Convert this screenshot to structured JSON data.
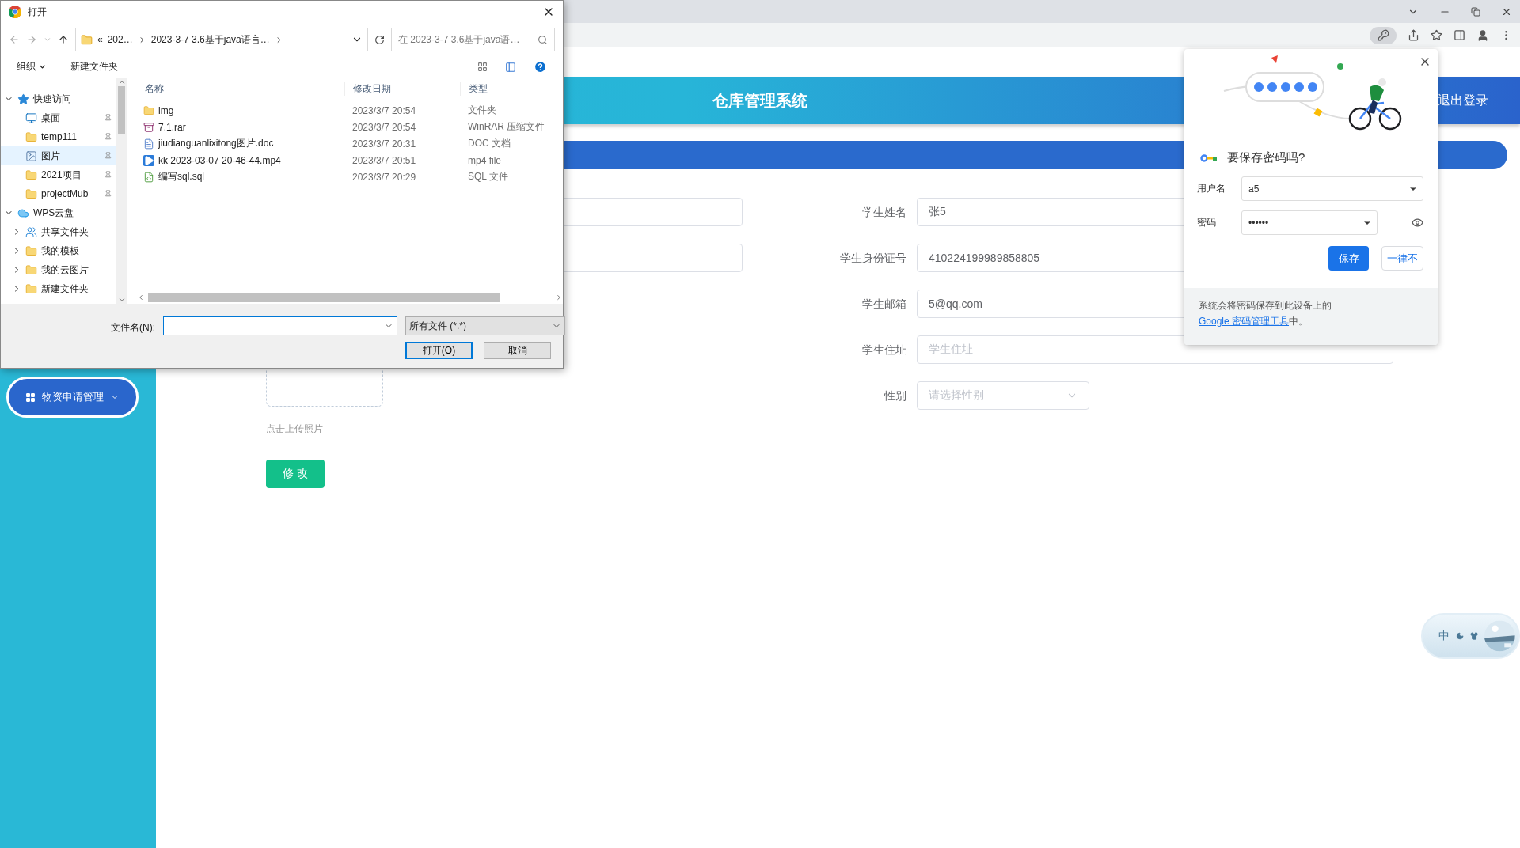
{
  "browser_toolbar": {
    "password_key_active": true
  },
  "app": {
    "title": "仓库管理系统",
    "logout": "退出登录"
  },
  "sidebar": {
    "items": [
      {
        "label": "物资申请管理",
        "expanded": false
      }
    ]
  },
  "form": {
    "left_column": [
      {
        "kind": "input"
      },
      {
        "kind": "input"
      }
    ],
    "fields": [
      {
        "label": "学生姓名",
        "kind": "input",
        "value": "张5"
      },
      {
        "label": "学生身份证号",
        "kind": "input",
        "value": "410224199989858805"
      },
      {
        "label": "学生邮箱",
        "kind": "input",
        "value": "5@qq.com"
      },
      {
        "label": "学生住址",
        "kind": "input",
        "placeholder": "学生住址"
      },
      {
        "label": "性别",
        "kind": "select",
        "placeholder": "请选择性别"
      }
    ],
    "upload_caption": "点击上传照片",
    "submit": "修 改"
  },
  "file_dialog": {
    "title": "打开",
    "breadcrumb_prefix": "«",
    "breadcrumb": [
      "202…",
      "2023-3-7 3.6基于java语言…"
    ],
    "search": {
      "placeholder": "在 2023-3-7 3.6基于java语…"
    },
    "commands": [
      {
        "label": "组织",
        "kind": "menu"
      },
      {
        "label": "新建文件夹",
        "kind": "button"
      }
    ],
    "nav": [
      {
        "label": "快速访问",
        "kind": "star",
        "expanded": true,
        "selected": false,
        "children": [
          {
            "label": "桌面",
            "kind": "desktop",
            "selected": false
          },
          {
            "label": "temp111",
            "kind": "folder",
            "selected": false
          },
          {
            "label": "图片",
            "kind": "pictures",
            "selected": true
          },
          {
            "label": "2021项目",
            "kind": "folder",
            "selected": false
          },
          {
            "label": "projectMub",
            "kind": "folder",
            "selected": false
          }
        ]
      },
      {
        "label": "WPS云盘",
        "kind": "cloud",
        "expanded": true,
        "selected": false,
        "children": [
          {
            "label": "共享文件夹",
            "kind": "shared",
            "expanded": false,
            "selected": false
          },
          {
            "label": "我的模板",
            "kind": "folder",
            "expanded": false,
            "selected": false
          },
          {
            "label": "我的云图片",
            "kind": "folder",
            "expanded": false,
            "selected": false
          },
          {
            "label": "新建文件夹",
            "kind": "folder",
            "expanded": false,
            "selected": false
          }
        ]
      }
    ],
    "columns": [
      "名称",
      "修改日期",
      "类型"
    ],
    "files": [
      {
        "name": "img",
        "date": "2023/3/7 20:54",
        "type": "文件夹",
        "kind": "folder"
      },
      {
        "name": "7.1.rar",
        "date": "2023/3/7 20:54",
        "type": "WinRAR 压缩文件",
        "kind": "archive"
      },
      {
        "name": "jiudianguanlixitong图片.doc",
        "date": "2023/3/7 20:31",
        "type": "DOC 文档",
        "kind": "doc"
      },
      {
        "name": "kk 2023-03-07 20-46-44.mp4",
        "date": "2023/3/7 20:51",
        "type": "mp4 file",
        "kind": "video"
      },
      {
        "name": "编写sql.sql",
        "date": "2023/3/7 20:29",
        "type": "SQL 文件",
        "kind": "sql"
      }
    ],
    "filename_label": "文件名(N):",
    "file_type": "所有文件 (*.*)",
    "buttons": [
      {
        "label": "打开(O)",
        "kind": "default"
      },
      {
        "label": "取消",
        "kind": "normal"
      }
    ]
  },
  "password_popup": {
    "title": "要保存密码吗?",
    "username_label": "用户名",
    "username": "a5",
    "password_label": "密码",
    "password": "••••••",
    "buttons": [
      {
        "label": "保存",
        "kind": "primary"
      },
      {
        "label": "一律不",
        "kind": "secondary"
      }
    ],
    "footer": {
      "text": "系统会将密码保存到此设备上的",
      "link": "Google 密码管理工具",
      "after": "中。"
    }
  },
  "ime_toolbar": {
    "mode": "中"
  }
}
